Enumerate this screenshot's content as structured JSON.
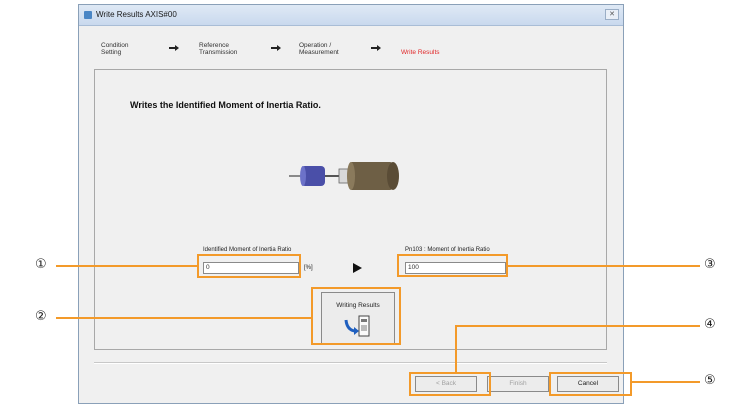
{
  "window": {
    "title": "Write Results AXIS#00",
    "close_glyph": "✕"
  },
  "steps": [
    {
      "line1": "Condition",
      "line2": "Setting"
    },
    {
      "line1": "Reference",
      "line2": "Transmission"
    },
    {
      "line1": "Operation /",
      "line2": "Measurement"
    },
    {
      "line1": "Write Results",
      "line2": ""
    }
  ],
  "main": {
    "headline": "Writes the Identified Moment of Inertia Ratio.",
    "identified": {
      "label": "Identified Moment of Inertia Ratio",
      "value": "0",
      "unit": "[%]"
    },
    "pn103": {
      "label": "Pn103   :  Moment of Inertia Ratio",
      "value": "100"
    },
    "write_button": "Writing Results"
  },
  "footer": {
    "back": "< Back",
    "finish": "Finish",
    "cancel": "Cancel"
  },
  "callouts": [
    "①",
    "②",
    "③",
    "④",
    "⑤"
  ],
  "colors": {
    "highlight": "#f39a2a",
    "active_step": "#e0282a",
    "motor_blue": "#4a4fa8"
  }
}
